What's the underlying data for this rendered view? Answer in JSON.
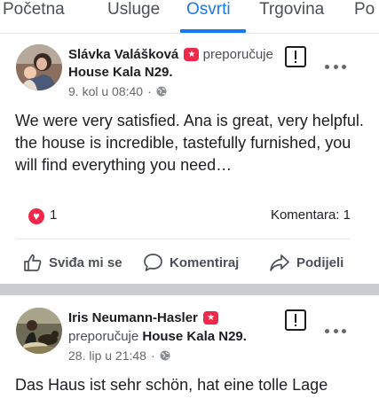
{
  "tabs": [
    {
      "label": "Početna"
    },
    {
      "label": "Usluge"
    },
    {
      "label": "Osvrti"
    },
    {
      "label": "Trgovina"
    },
    {
      "label": "Po"
    }
  ],
  "active_tab": "Osvrti",
  "accent_color": "#1877f2",
  "posts": [
    {
      "author": "Slávka Valášková",
      "badge_icon": "star-badge-icon",
      "recommends": "preporučuje",
      "page": "House Kala N29.",
      "date": "9. kol u 08:40",
      "dot": "·",
      "audience_icon": "globe-icon",
      "text": "We were very satisfied. Ana is great, very helpful. the house is incredible, tastefully furnished, you will find everything you need…",
      "reaction_count": "1",
      "comments": "Komentara: 1"
    },
    {
      "author": "Iris Neumann-Hasler",
      "badge_icon": "star-badge-icon",
      "recommends": "preporučuje",
      "page": "House Kala N29.",
      "date": "28. lip u 21:48",
      "dot": "·",
      "audience_icon": "globe-icon",
      "text": "Das Haus ist sehr schön, hat eine tolle Lage"
    }
  ],
  "actions": {
    "like": "Sviđa mi se",
    "comment": "Komentiraj",
    "share": "Podijeli"
  }
}
